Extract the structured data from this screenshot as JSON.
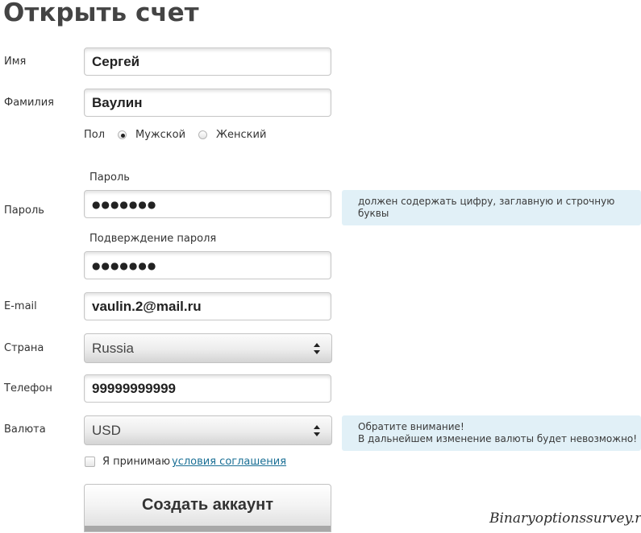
{
  "page": {
    "title": "Открыть счет"
  },
  "form": {
    "first_name": {
      "label": "Имя",
      "value": "Сергей"
    },
    "last_name": {
      "label": "Фамилия",
      "value": "Ваулин"
    },
    "gender": {
      "label": "Пол",
      "male": "Мужской",
      "female": "Женский",
      "selected": "male"
    },
    "password": {
      "label": "Пароль",
      "sublabel": "Пароль",
      "value": "●●●●●●●",
      "hint": "должен содержать цифру, заглавную и строчную буквы"
    },
    "password_confirm": {
      "sublabel": "Подверждение пароля",
      "value": "●●●●●●●"
    },
    "email": {
      "label": "E-mail",
      "value": "vaulin.2@mail.ru"
    },
    "country": {
      "label": "Страна",
      "value": "Russia"
    },
    "phone": {
      "label": "Телефон",
      "value": "99999999999"
    },
    "currency": {
      "label": "Валюта",
      "value": "USD",
      "hint_line1": "Обратите внимание!",
      "hint_line2": "В дальнейшем изменение валюты будет невозможно!"
    },
    "agreement": {
      "prefix": "Я принимаю",
      "link": "условия соглашения",
      "checked": false
    },
    "submit_label": "Создать аккаунт"
  },
  "watermark": "Binaryoptionssurvey.ru"
}
